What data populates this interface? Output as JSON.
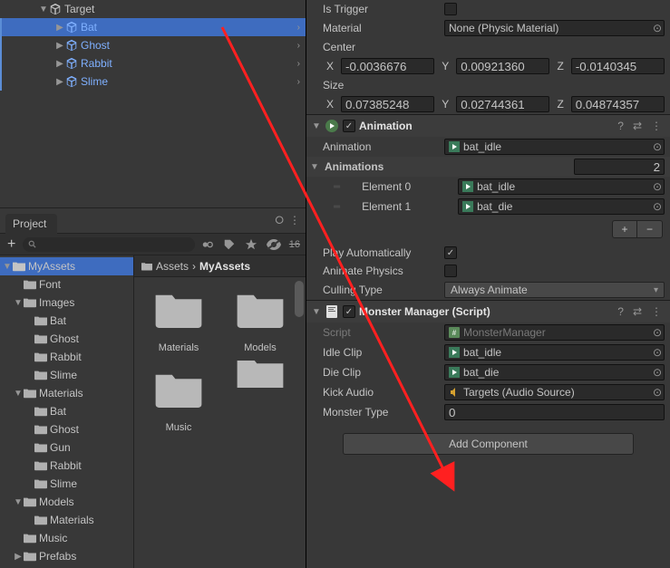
{
  "hierarchy": {
    "root": "Target",
    "children": [
      "Bat",
      "Ghost",
      "Rabbit",
      "Slime"
    ],
    "selected": "Bat"
  },
  "project": {
    "tab": "Project",
    "hidden_count": "16",
    "breadcrumb_root": "Assets",
    "breadcrumb_sep": "›",
    "breadcrumb_current": "MyAssets",
    "tree": {
      "root": "MyAssets",
      "items": [
        "Font",
        "Images",
        "Bat",
        "Ghost",
        "Rabbit",
        "Slime",
        "Materials",
        "Bat",
        "Ghost",
        "Gun",
        "Rabbit",
        "Slime",
        "Models",
        "Materials",
        "Music",
        "Prefabs"
      ]
    },
    "grid": [
      "Materials",
      "Models",
      "Music"
    ]
  },
  "inspector": {
    "collider": {
      "is_trigger": "Is Trigger",
      "material": "Material",
      "material_val": "None (Physic Material)",
      "center": "Center",
      "center_x": "-0.0036676",
      "center_y": "0.00921360",
      "center_z": "-0.0140345",
      "size": "Size",
      "size_x": "0.07385248",
      "size_y": "0.02744361",
      "size_z": "0.04874357"
    },
    "animation": {
      "title": "Animation",
      "anim_label": "Animation",
      "anim_val": "bat_idle",
      "anims_label": "Animations",
      "anims_count": "2",
      "el0_label": "Element 0",
      "el0_val": "bat_idle",
      "el1_label": "Element 1",
      "el1_val": "bat_die",
      "play_auto": "Play Automatically",
      "animate_physics": "Animate Physics",
      "culling": "Culling Type",
      "culling_val": "Always Animate"
    },
    "monster": {
      "title": "Monster Manager (Script)",
      "script": "Script",
      "script_val": "MonsterManager",
      "idle": "Idle Clip",
      "idle_val": "bat_idle",
      "die": "Die Clip",
      "die_val": "bat_die",
      "kick": "Kick Audio",
      "kick_val": "Targets (Audio Source)",
      "type": "Monster Type",
      "type_val": "0"
    },
    "add_component": "Add Component"
  },
  "axis": {
    "x": "X",
    "y": "Y",
    "z": "Z"
  }
}
